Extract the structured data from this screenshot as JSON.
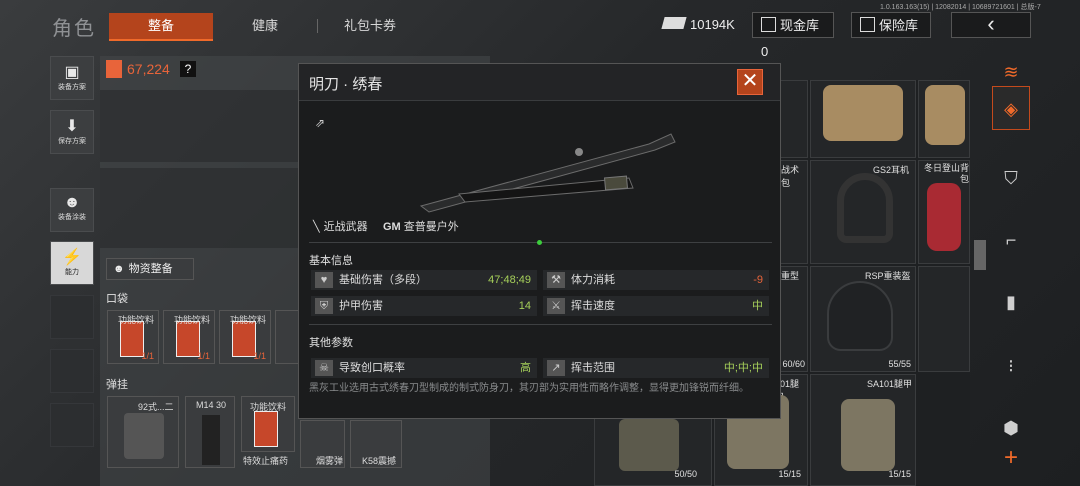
{
  "version": "1.0.163.163(15) | 12082014 | 10689721601 | 总版-7",
  "header": {
    "brand": "角色",
    "tabs": [
      "整备",
      "健康",
      "礼包卡券"
    ],
    "currency": "10194K",
    "cash_vault": "现金库 0",
    "safe": "保险库"
  },
  "left_sidebar": {
    "items": [
      "装备方案",
      "保存方案",
      "装备涂装",
      "能力"
    ]
  },
  "loadout": {
    "value": "67,224",
    "help": "?",
    "supply_button": "物资整备",
    "pouch_label": "口袋",
    "pouch_items": [
      {
        "label": "功能饮料",
        "count": "1/1"
      },
      {
        "label": "功能饮料",
        "count": "1/1"
      },
      {
        "label": "功能饮料",
        "count": "1/1"
      }
    ],
    "rig_label": "弹挂",
    "rig_items": [
      {
        "label": "92式战术背心二级",
        "short": "92式...二级"
      },
      {
        "label": "M14 30",
        "short": "M14 30"
      },
      {
        "label": "功能饮料",
        "short": "功能饮料"
      }
    ],
    "bottom_labels": [
      "特效止痛药",
      "烟雾弹",
      "K58震撼"
    ]
  },
  "inventory": {
    "names": [
      "战术包",
      "GS2耳机",
      "冬日登山背包",
      "重型",
      "RSP重装盔",
      "101腿甲",
      "SA101腿甲"
    ],
    "counts": [
      "60/60",
      "55/55",
      "50/50",
      "15/15",
      "15/15"
    ]
  },
  "modal": {
    "title": "明刀 · 绣春",
    "type": "近战武器",
    "brand_logo": "GM",
    "brand": "查普曼户外",
    "basic_info_label": "基本信息",
    "stats": [
      {
        "icon": "heart-broken-icon",
        "label": "基础伤害（多段）",
        "value": "47;48;49",
        "color": "#a6d05a"
      },
      {
        "icon": "stamina-icon",
        "label": "体力消耗",
        "value": "-9",
        "color": "#e8643a"
      },
      {
        "icon": "armor-damage-icon",
        "label": "护甲伤害",
        "value": "14",
        "color": "#a6d05a"
      },
      {
        "icon": "swing-speed-icon",
        "label": "挥击速度",
        "value": "中",
        "color": "#a6d05a"
      }
    ],
    "other_label": "其他参数",
    "other_stats": [
      {
        "icon": "bleed-icon",
        "label": "导致创口概率",
        "value": "高",
        "color": "#a6d05a"
      },
      {
        "icon": "swing-range-icon",
        "label": "挥击范围",
        "value": "中;中;中",
        "color": "#a6d05a"
      }
    ],
    "description": "黑灰工业选用古式绣春刀型制成的制式防身刀，其刃部为实用性而略作调整，显得更加锋锐而纤细。"
  },
  "colors": {
    "accent": "#b4441c",
    "value_green": "#a6d05a",
    "value_red": "#e8643a"
  }
}
